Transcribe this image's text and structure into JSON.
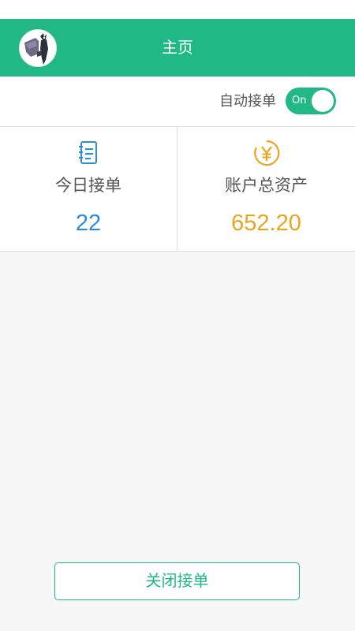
{
  "header": {
    "title": "主页",
    "avatar_icon": "bat-avatar-icon",
    "background_color": "#20b884"
  },
  "auto_accept": {
    "label": "自动接单",
    "toggle_text": "On",
    "enabled": true
  },
  "stats": [
    {
      "label": "今日接单",
      "value": "22",
      "icon": "notebook-icon",
      "color": "#2b8fd6"
    },
    {
      "label": "账户总资产",
      "value": "652.20",
      "icon": "yen-coin-icon",
      "color": "#e9a520"
    }
  ],
  "footer": {
    "close_button_label": "关闭接单"
  }
}
